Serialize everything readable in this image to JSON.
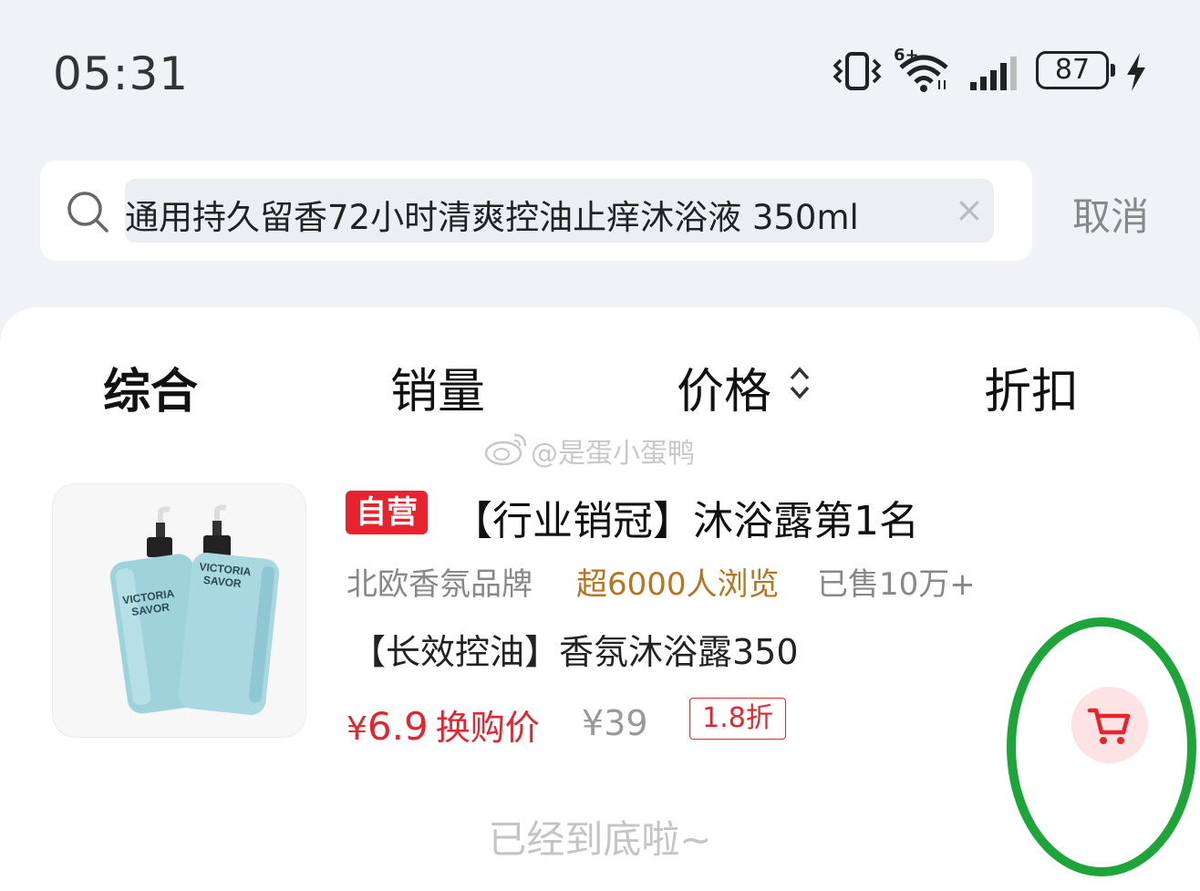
{
  "status_bar": {
    "time": "05:31",
    "network_label": "6+",
    "battery": "87",
    "icons": [
      "vibrate-icon",
      "wifi-icon",
      "signal-icon",
      "battery-icon",
      "charging-icon"
    ]
  },
  "search": {
    "query": "通用持久留香72小时清爽控油止痒沐浴液 350ml",
    "clear_icon": "×",
    "cancel_label": "取消"
  },
  "tabs": [
    {
      "label": "综合",
      "active": true
    },
    {
      "label": "销量",
      "active": false
    },
    {
      "label": "价格",
      "active": false,
      "icon": "sort-icon"
    },
    {
      "label": "折扣",
      "active": false
    }
  ],
  "watermark": "@是蛋小蛋鸭",
  "product": {
    "badge": "自营",
    "title": "【行业销冠】沐浴露第1名",
    "brand": "北欧香氛品牌",
    "views": "超6000人浏览",
    "sold": "已售10万+",
    "subtitle": "【长效控油】香氛沐浴露350",
    "image_text": [
      "VICTORIA",
      "SAVOR"
    ],
    "price_symbol": "¥",
    "price_value": "6.9",
    "price_label": "换购价",
    "original_price": "¥39",
    "discount": "1.8折",
    "cart_icon": "cart-icon"
  },
  "end_text": "已经到底啦~",
  "colors": {
    "accent_red": "#e8232e",
    "highlight_green": "#1ea53a",
    "views_orange": "#b8741f",
    "background": "#f1f2f5"
  }
}
